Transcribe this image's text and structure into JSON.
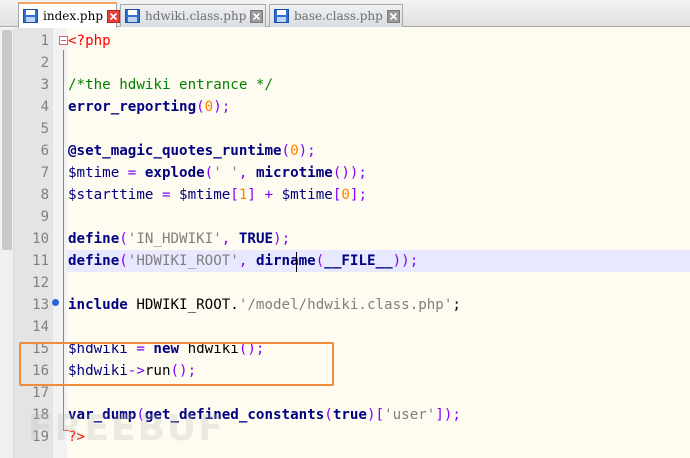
{
  "tabs": [
    {
      "label": "index.php",
      "active": true
    },
    {
      "label": "hdwiki.class.php",
      "active": false
    },
    {
      "label": "base.class.php",
      "active": false
    }
  ],
  "watermark": "FREEBUF",
  "lines": [
    {
      "n": "1"
    },
    {
      "n": "2"
    },
    {
      "n": "3"
    },
    {
      "n": "4"
    },
    {
      "n": "5"
    },
    {
      "n": "6"
    },
    {
      "n": "7"
    },
    {
      "n": "8"
    },
    {
      "n": "9"
    },
    {
      "n": "10"
    },
    {
      "n": "11"
    },
    {
      "n": "12"
    },
    {
      "n": "13"
    },
    {
      "n": "14"
    },
    {
      "n": "15"
    },
    {
      "n": "16"
    },
    {
      "n": "17"
    },
    {
      "n": "18"
    },
    {
      "n": "19"
    }
  ],
  "code": {
    "l1": "<?php",
    "l3": "/*the hdwiki entrance */",
    "l4_fn": "error_reporting",
    "l4_p1": "(",
    "l4_num": "0",
    "l4_p2": ");",
    "l6_fn": "@set_magic_quotes_runtime",
    "l6_p1": "(",
    "l6_num": "0",
    "l6_p2": ");",
    "l7_var": "$mtime",
    "l7_eq": " = ",
    "l7_fn": "explode",
    "l7_p1": "(",
    "l7_str": "' '",
    "l7_c": ", ",
    "l7_fn2": "microtime",
    "l7_p2": "());",
    "l8_var": "$starttime",
    "l8_eq": " = ",
    "l8_var2": "$mtime",
    "l8_b1": "[",
    "l8_n1": "1",
    "l8_b2": "]",
    "l8_plus": " + ",
    "l8_var3": "$mtime",
    "l8_b3": "[",
    "l8_n2": "0",
    "l8_b4": "];",
    "l10_fn": "define",
    "l10_p1": "(",
    "l10_str": "'IN_HDWIKI'",
    "l10_c": ", ",
    "l10_cst": "TRUE",
    "l10_p2": ");",
    "l11_fn": "define",
    "l11_p1": "(",
    "l11_str": "'HDWIKI_ROOT'",
    "l11_c": ", ",
    "l11_fn2": "dirname",
    "l11_p2": "(",
    "l11_cst": "__FILE__",
    "l11_p3": "));",
    "l13_kw": "include",
    "l13_plain": " HDWIKI_ROOT.",
    "l13_str": "'/model/hdwiki.class.php'",
    "l13_end": ";",
    "l15_var": "$hdwiki",
    "l15_eq": " = ",
    "l15_kw": "new",
    "l15_plain": " hdwiki",
    "l15_p": "();",
    "l16_var": "$hdwiki",
    "l16_arrow": "->",
    "l16_plain": "run",
    "l16_p": "();",
    "l18_fn": "var_dump",
    "l18_p1": "(",
    "l18_fn2": "get_defined_constants",
    "l18_p2": "(",
    "l18_cst": "true",
    "l18_p3": ")[",
    "l18_str": "'user'",
    "l18_p4": "]);",
    "l19": "?>"
  }
}
